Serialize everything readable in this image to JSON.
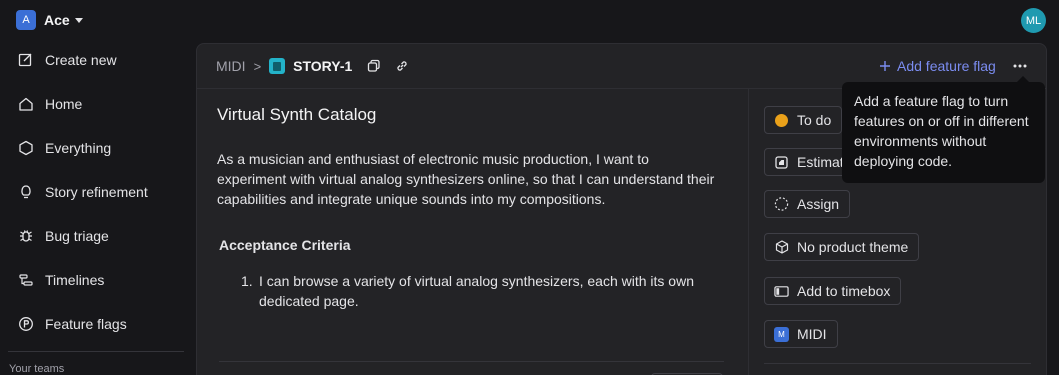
{
  "workspace": {
    "badge": "A",
    "name": "Ace"
  },
  "user": {
    "initials": "ML"
  },
  "sidebar": {
    "items": [
      {
        "label": "Create new",
        "icon": "create-icon"
      },
      {
        "label": "Home",
        "icon": "home-icon"
      },
      {
        "label": "Everything",
        "icon": "hexagon-icon"
      },
      {
        "label": "Story refinement",
        "icon": "lightbulb-icon"
      },
      {
        "label": "Bug triage",
        "icon": "bug-icon"
      },
      {
        "label": "Timelines",
        "icon": "timeline-icon"
      },
      {
        "label": "Feature flags",
        "icon": "feature-flag-icon"
      }
    ],
    "teams_label": "Your teams"
  },
  "breadcrumb": {
    "project": "MIDI",
    "separator": ">",
    "story_id": "STORY-1"
  },
  "header": {
    "add_flag_label": "Add feature flag"
  },
  "story": {
    "title": "Virtual Synth Catalog",
    "description": "As a musician and enthusiast of electronic music production, I want to experiment with virtual analog synthesizers online, so that I can understand their capabilities and integrate unique sounds into my compositions.",
    "acceptance_title": "Acceptance Criteria",
    "criteria": [
      {
        "num": "1.",
        "text": "I can browse a variety of virtual analog synthesizers, each with its own dedicated page."
      }
    ]
  },
  "attributes": {
    "status": "To do",
    "estimate": "Estimate",
    "assign": "Assign",
    "theme": "No product theme",
    "timebox": "Add to timebox",
    "project_badge": "M",
    "project": "MIDI"
  },
  "tooltip": {
    "text": "Add a feature flag to turn features on or off in different environments without deploying code."
  },
  "colors": {
    "accent": "#7b8cf0",
    "status_todo": "#eaa11a",
    "story_badge": "#23b3c9",
    "avatar": "#1f9ab0"
  }
}
